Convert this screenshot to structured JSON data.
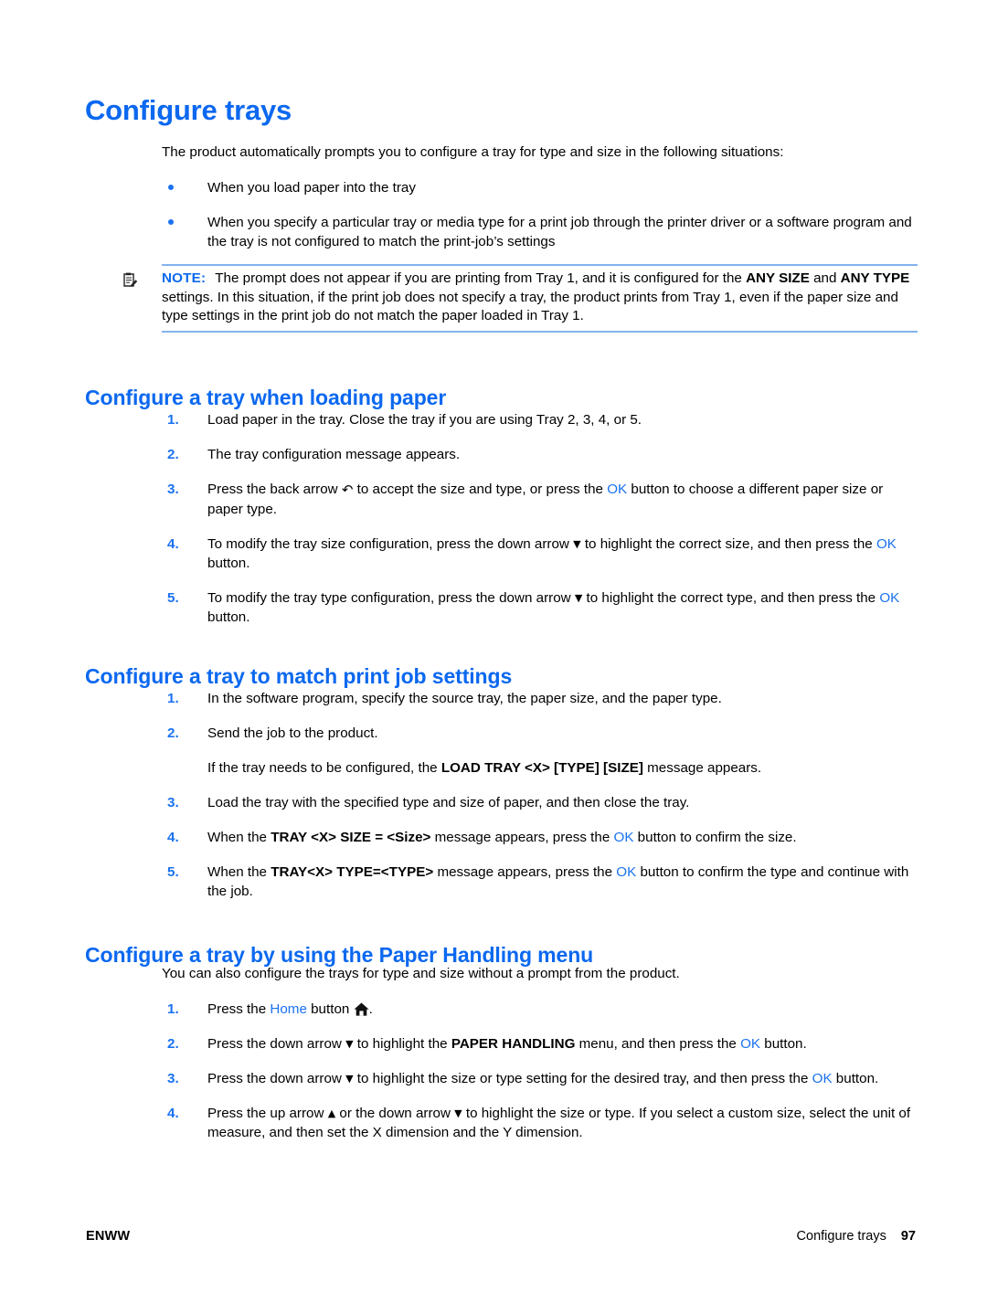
{
  "document": {
    "title": "Configure trays",
    "intro": "The product automatically prompts you to configure a tray for type and size in the following situations:"
  },
  "intro_bullets": [
    "When you load paper into the tray",
    "When you specify a particular tray or media type for a print job through the printer driver or a software program and the tray is not configured to match the print-job’s settings"
  ],
  "note": {
    "icon": "note-clipboard-icon",
    "label": "NOTE:",
    "text_1": "The prompt does not appear if you are printing from Tray 1, and it is configured for the ",
    "bold_1": "ANY SIZE",
    "text_2": " and ",
    "bold_2": "ANY TYPE",
    "text_3": " settings. In this situation, if the print job does not specify a tray, the product prints from Tray 1, even if the paper size and type settings in the print job do not match the paper loaded in Tray 1."
  },
  "section_1": {
    "heading": "Configure a tray when loading paper",
    "steps": [
      {
        "num": "1.",
        "parts": [
          {
            "t": "text",
            "v": "Load paper in the tray. Close the tray if you are using Tray 2, 3, 4, or 5."
          }
        ]
      },
      {
        "num": "2.",
        "parts": [
          {
            "t": "text",
            "v": "The tray configuration message appears."
          }
        ]
      },
      {
        "num": "3.",
        "parts": [
          {
            "t": "text",
            "v": "Press the back arrow "
          },
          {
            "t": "glyph",
            "v": "back-arrow-icon",
            "g": "↶"
          },
          {
            "t": "text",
            "v": " to accept the size and type, or press the "
          },
          {
            "t": "blue",
            "v": "OK"
          },
          {
            "t": "text",
            "v": " button to choose a different paper size or paper type."
          }
        ]
      },
      {
        "num": "4.",
        "parts": [
          {
            "t": "text",
            "v": "To modify the tray size configuration, press the down arrow "
          },
          {
            "t": "glyph",
            "v": "down-arrow-icon",
            "g": "▼"
          },
          {
            "t": "text",
            "v": " to highlight the correct size, and then press the "
          },
          {
            "t": "blue",
            "v": "OK"
          },
          {
            "t": "text",
            "v": " button."
          }
        ]
      },
      {
        "num": "5.",
        "parts": [
          {
            "t": "text",
            "v": "To modify the tray type configuration, press the down arrow "
          },
          {
            "t": "glyph",
            "v": "down-arrow-icon",
            "g": "▼"
          },
          {
            "t": "text",
            "v": " to highlight the correct type, and then press the "
          },
          {
            "t": "blue",
            "v": "OK"
          },
          {
            "t": "text",
            "v": " button."
          }
        ]
      }
    ]
  },
  "section_2": {
    "heading": "Configure a tray to match print job settings",
    "steps": [
      {
        "num": "1.",
        "parts": [
          {
            "t": "text",
            "v": "In the software program, specify the source tray, the paper size, and the paper type."
          }
        ]
      },
      {
        "num": "2.",
        "parts": [
          {
            "t": "text",
            "v": "Send the job to the product."
          }
        ],
        "sub": [
          {
            "t": "text",
            "v": "If the tray needs to be configured, the "
          },
          {
            "t": "bold",
            "v": "LOAD TRAY <X> [TYPE] [SIZE]"
          },
          {
            "t": "text",
            "v": " message appears."
          }
        ]
      },
      {
        "num": "3.",
        "parts": [
          {
            "t": "text",
            "v": "Load the tray with the specified type and size of paper, and then close the tray."
          }
        ]
      },
      {
        "num": "4.",
        "parts": [
          {
            "t": "text",
            "v": "When the "
          },
          {
            "t": "bold",
            "v": "TRAY <X> SIZE = <Size>"
          },
          {
            "t": "text",
            "v": " message appears, press the "
          },
          {
            "t": "blue",
            "v": "OK"
          },
          {
            "t": "text",
            "v": " button to confirm the size."
          }
        ]
      },
      {
        "num": "5.",
        "parts": [
          {
            "t": "text",
            "v": "When the "
          },
          {
            "t": "bold",
            "v": "TRAY<X> TYPE=<TYPE>"
          },
          {
            "t": "text",
            "v": " message appears, press the "
          },
          {
            "t": "blue",
            "v": "OK"
          },
          {
            "t": "text",
            "v": " button to confirm the type and continue with the job."
          }
        ]
      }
    ]
  },
  "section_3": {
    "heading": "Configure a tray by using the Paper Handling menu",
    "intro": "You can also configure the trays for type and size without a prompt from the product.",
    "steps": [
      {
        "num": "1.",
        "parts": [
          {
            "t": "text",
            "v": "Press the "
          },
          {
            "t": "blue",
            "v": "Home"
          },
          {
            "t": "text",
            "v": " button "
          },
          {
            "t": "home",
            "v": "home-icon"
          },
          {
            "t": "text",
            "v": "."
          }
        ]
      },
      {
        "num": "2.",
        "parts": [
          {
            "t": "text",
            "v": "Press the down arrow "
          },
          {
            "t": "glyph",
            "v": "down-arrow-icon",
            "g": "▼"
          },
          {
            "t": "text",
            "v": " to highlight the "
          },
          {
            "t": "bold",
            "v": "PAPER HANDLING"
          },
          {
            "t": "text",
            "v": " menu, and then press the "
          },
          {
            "t": "blue",
            "v": "OK"
          },
          {
            "t": "text",
            "v": " button."
          }
        ]
      },
      {
        "num": "3.",
        "parts": [
          {
            "t": "text",
            "v": "Press the down arrow "
          },
          {
            "t": "glyph",
            "v": "down-arrow-icon",
            "g": "▼"
          },
          {
            "t": "text",
            "v": " to highlight the size or type setting for the desired tray, and then press the "
          },
          {
            "t": "blue",
            "v": "OK"
          },
          {
            "t": "text",
            "v": " button."
          }
        ]
      },
      {
        "num": "4.",
        "parts": [
          {
            "t": "text",
            "v": "Press the up arrow "
          },
          {
            "t": "glyph",
            "v": "up-arrow-icon",
            "g": "▲"
          },
          {
            "t": "text",
            "v": " or the down arrow "
          },
          {
            "t": "glyph",
            "v": "down-arrow-icon",
            "g": "▼"
          },
          {
            "t": "text",
            "v": " to highlight the size or type. If you select a custom size, select the unit of measure, and then set the X dimension and the Y dimension."
          }
        ]
      }
    ]
  },
  "footer": {
    "left": "ENWW",
    "right_title": "Configure trays",
    "page_number": "97"
  },
  "colors": {
    "heading_blue": "#0b68f0",
    "accent_blue": "#1a72f0",
    "rule_blue": "#84b3ef",
    "text_black": "#000000",
    "background": "#ffffff"
  }
}
